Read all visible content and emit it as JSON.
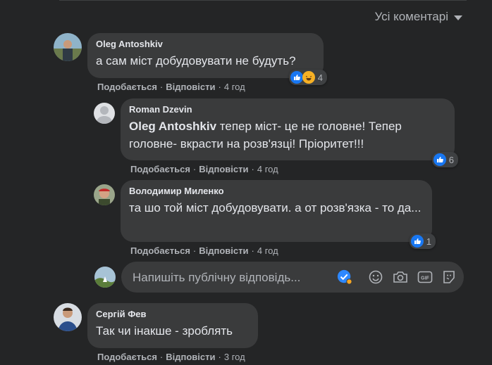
{
  "sort_label": "Усі коментарі",
  "actions": {
    "like": "Подобається",
    "reply": "Відповісти",
    "sep": "·"
  },
  "comments": [
    {
      "author": "Oleg Antoshkiv",
      "text": "а сам міст добудовувати не будуть?",
      "time": "4 год",
      "reactions_count": "4"
    },
    {
      "author": "Roman Dzevin",
      "mention": "Oleg Antoshkiv",
      "text": " тепер міст- це не головне! Тепер головне- вкрасти на розв'язці! Пріоритет!!!",
      "time": "4 год",
      "reactions_count": "6"
    },
    {
      "author": "Володимир Миленко",
      "text": "та шо той міст добудовувати. а от розв'язка - то да...",
      "time": "4 год",
      "reactions_count": "1"
    },
    {
      "author": "Сергій Фев",
      "text": "Так чи інакше - зроблять",
      "time": "3 год"
    }
  ],
  "reply": {
    "placeholder": "Напишіть публічну відповідь..."
  },
  "colors": {
    "accent": "#1877f2",
    "bubble": "#3a3b3c",
    "background": "#242526"
  }
}
